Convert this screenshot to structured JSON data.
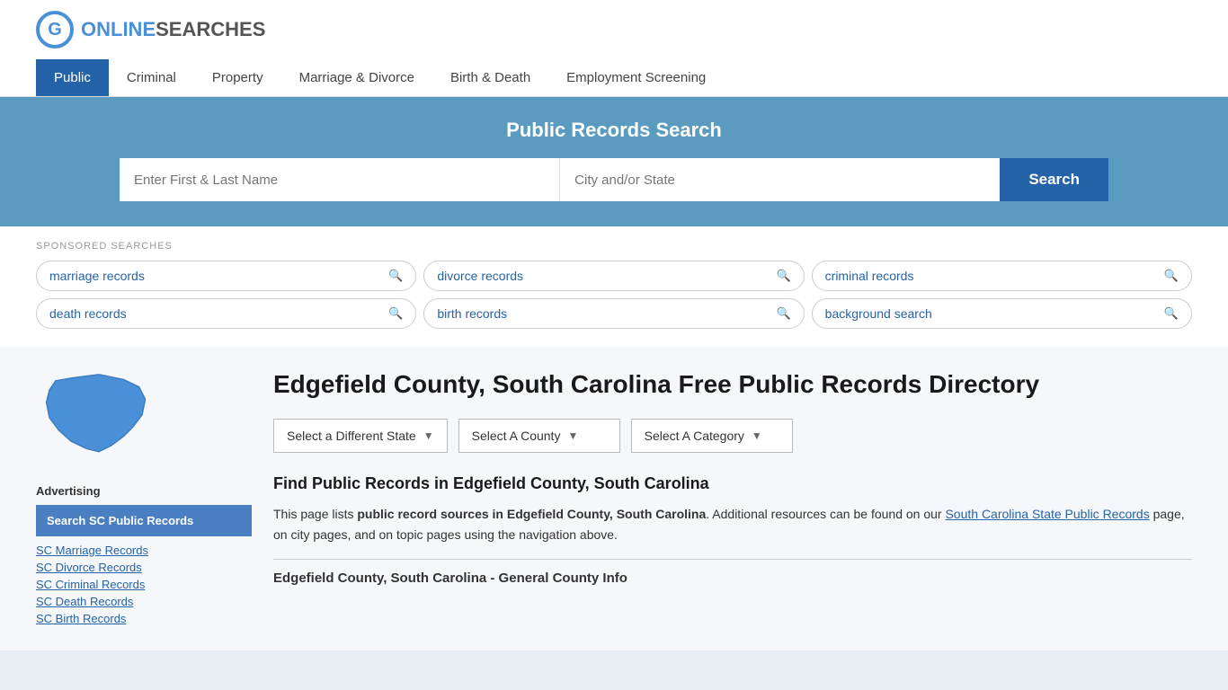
{
  "header": {
    "logo_online": "ONLINE",
    "logo_searches": "SEARCHES"
  },
  "nav": {
    "items": [
      {
        "label": "Public",
        "active": true
      },
      {
        "label": "Criminal",
        "active": false
      },
      {
        "label": "Property",
        "active": false
      },
      {
        "label": "Marriage & Divorce",
        "active": false
      },
      {
        "label": "Birth & Death",
        "active": false
      },
      {
        "label": "Employment Screening",
        "active": false
      }
    ]
  },
  "search_banner": {
    "title": "Public Records Search",
    "name_placeholder": "Enter First & Last Name",
    "location_placeholder": "City and/or State",
    "button_label": "Search"
  },
  "sponsored": {
    "label": "SPONSORED SEARCHES",
    "pills": [
      {
        "text": "marriage records"
      },
      {
        "text": "divorce records"
      },
      {
        "text": "criminal records"
      },
      {
        "text": "death records"
      },
      {
        "text": "birth records"
      },
      {
        "text": "background search"
      }
    ]
  },
  "sidebar": {
    "advertising_label": "Advertising",
    "ad_box_label": "Search SC Public Records",
    "links": [
      "SC Marriage Records",
      "SC Divorce Records",
      "SC Criminal Records",
      "SC Death Records",
      "SC Birth Records"
    ]
  },
  "content": {
    "title": "Edgefield County, South Carolina Free Public Records Directory",
    "dropdowns": [
      {
        "label": "Select a Different State"
      },
      {
        "label": "Select A County"
      },
      {
        "label": "Select A Category"
      }
    ],
    "find_title": "Find Public Records in Edgefield County, South Carolina",
    "description_part1": "This page lists ",
    "description_bold": "public record sources in Edgefield County, South Carolina",
    "description_part2": ". Additional resources can be found on our ",
    "description_link": "South Carolina State Public Records",
    "description_part3": " page, on city pages, and on topic pages using the navigation above.",
    "general_info_label": "Edgefield County, South Carolina - General County Info"
  }
}
